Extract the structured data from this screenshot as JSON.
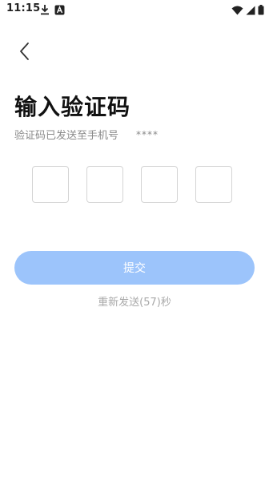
{
  "status_bar": {
    "time": "11:15",
    "left_icons": [
      "download-icon",
      "app-notification-icon"
    ],
    "right_icons": [
      "wifi-icon",
      "cellular-signal-icon",
      "battery-icon"
    ]
  },
  "header": {
    "back_icon": "chevron-left-icon"
  },
  "title": "输入验证码",
  "subtitle": {
    "text": "验证码已发送至手机号",
    "phone": "****"
  },
  "code_inputs": [
    "",
    "",
    "",
    ""
  ],
  "submit_label": "提交",
  "resend_label": "重新发送(57)秒",
  "colors": {
    "primary_disabled": "#9cc4fb",
    "box_border": "#d4d4d4",
    "muted_text": "#8a8a8a"
  }
}
